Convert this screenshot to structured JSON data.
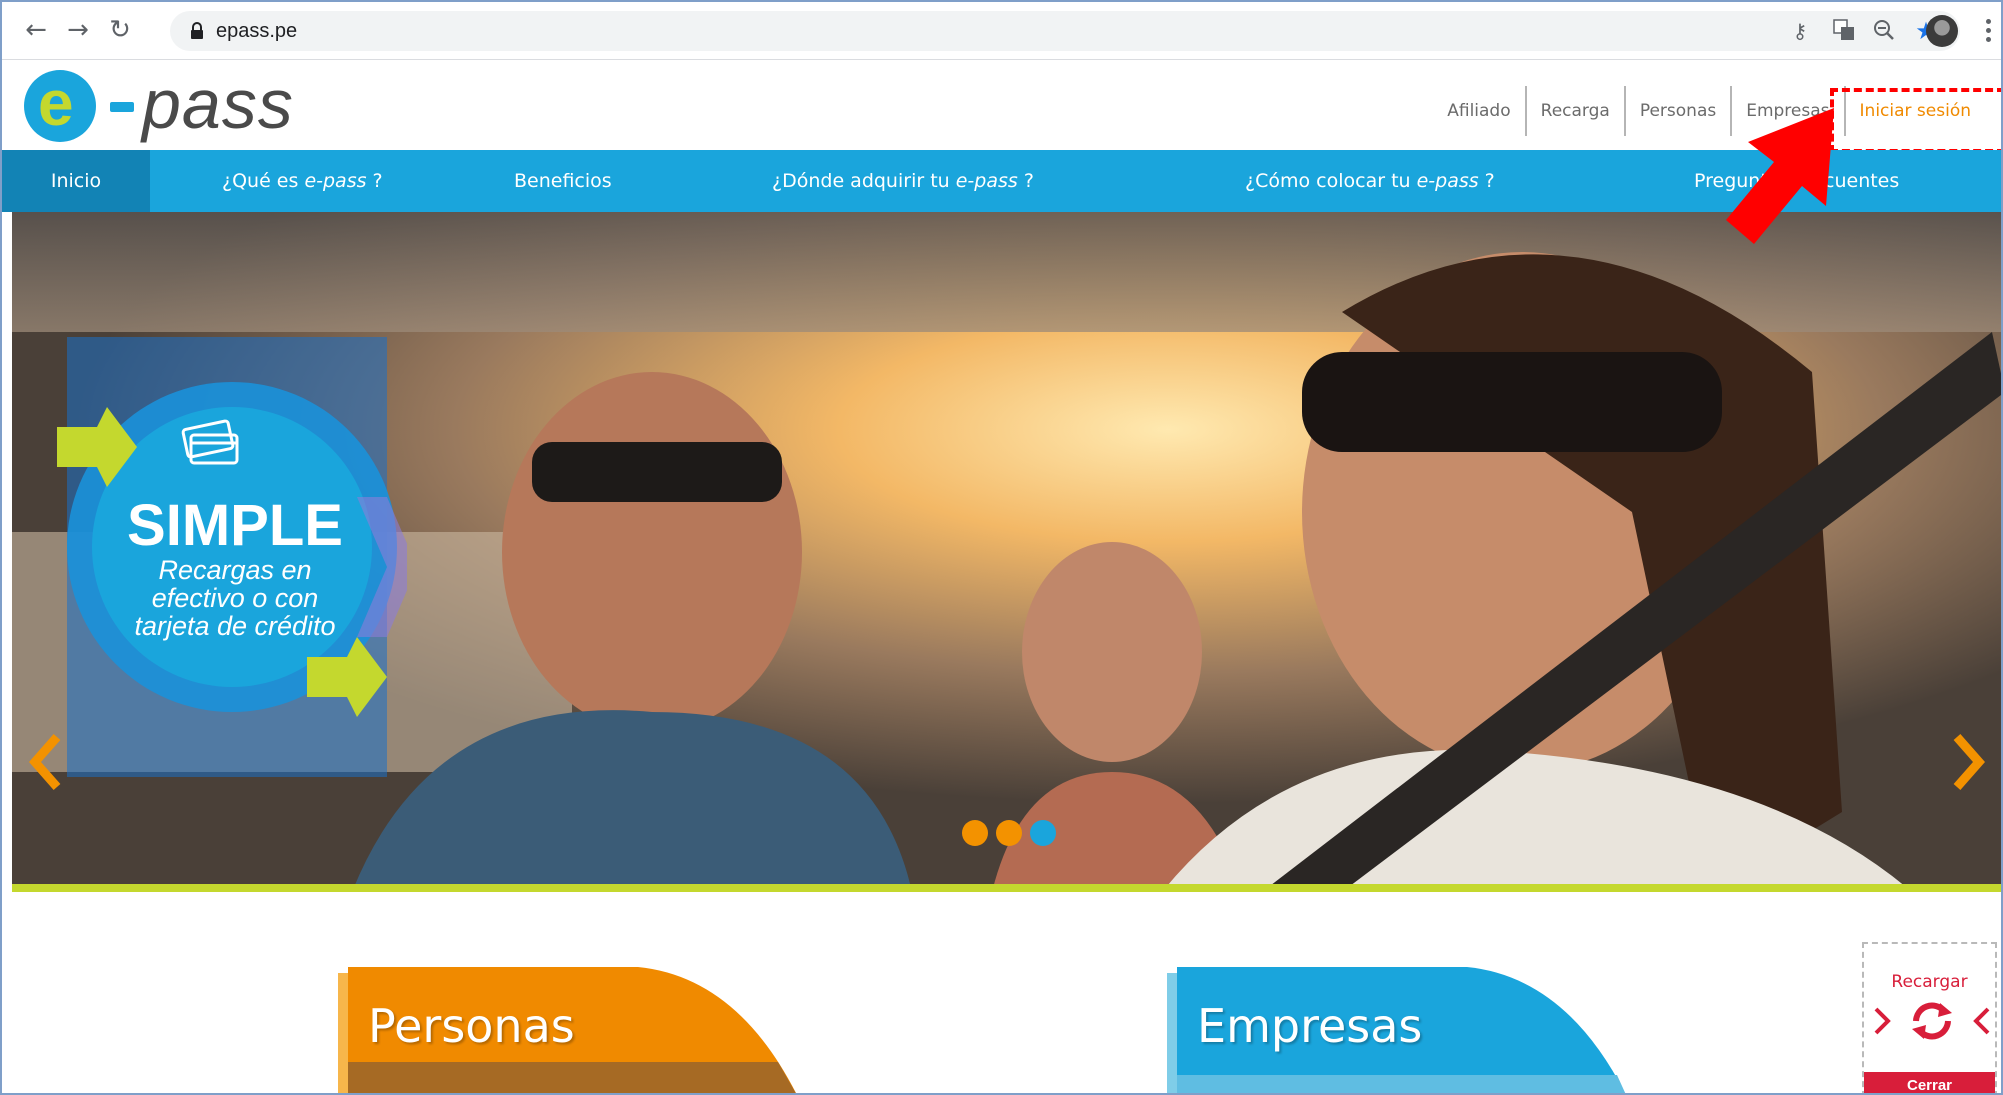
{
  "browser": {
    "url": "epass.pe",
    "icons": [
      "back-arrow-icon",
      "forward-arrow-icon",
      "reload-icon",
      "lock-icon",
      "key-icon",
      "translate-icon",
      "zoom-icon",
      "star-icon",
      "profile-avatar",
      "menu-dots-icon"
    ]
  },
  "header": {
    "logo_mark": "e",
    "logo_text": "pass",
    "top_links": [
      "Afiliado",
      "Recarga",
      "Personas",
      "Empresas",
      "Iniciar sesión"
    ]
  },
  "nav": {
    "items": [
      {
        "label_pre": "Inicio",
        "label_em": "",
        "label_post": ""
      },
      {
        "label_pre": "¿Qué es ",
        "label_em": "e-pass",
        "label_post": " ?"
      },
      {
        "label_pre": "Beneficios",
        "label_em": "",
        "label_post": ""
      },
      {
        "label_pre": "¿Dónde adquirir tu ",
        "label_em": "e-pass",
        "label_post": " ?"
      },
      {
        "label_pre": "¿Cómo colocar tu ",
        "label_em": "e-pass",
        "label_post": " ?"
      },
      {
        "label_pre": "Preguntas Frecuentes",
        "label_em": "",
        "label_post": ""
      }
    ]
  },
  "hero": {
    "title": "SIMPLE",
    "description_lines": [
      "Recargas en",
      "efectivo o con",
      "tarjeta de crédito"
    ],
    "slide_count": 3,
    "active_slide": 3
  },
  "cards": {
    "personas": "Personas",
    "empresas": "Empresas"
  },
  "widget": {
    "recargar": "Recargar",
    "cerrar": "Cerrar"
  },
  "colors": {
    "brand_blue": "#1aa5dc",
    "brand_green": "#c4d82e",
    "brand_orange": "#f08a00",
    "alert_red": "#d81e3a"
  }
}
